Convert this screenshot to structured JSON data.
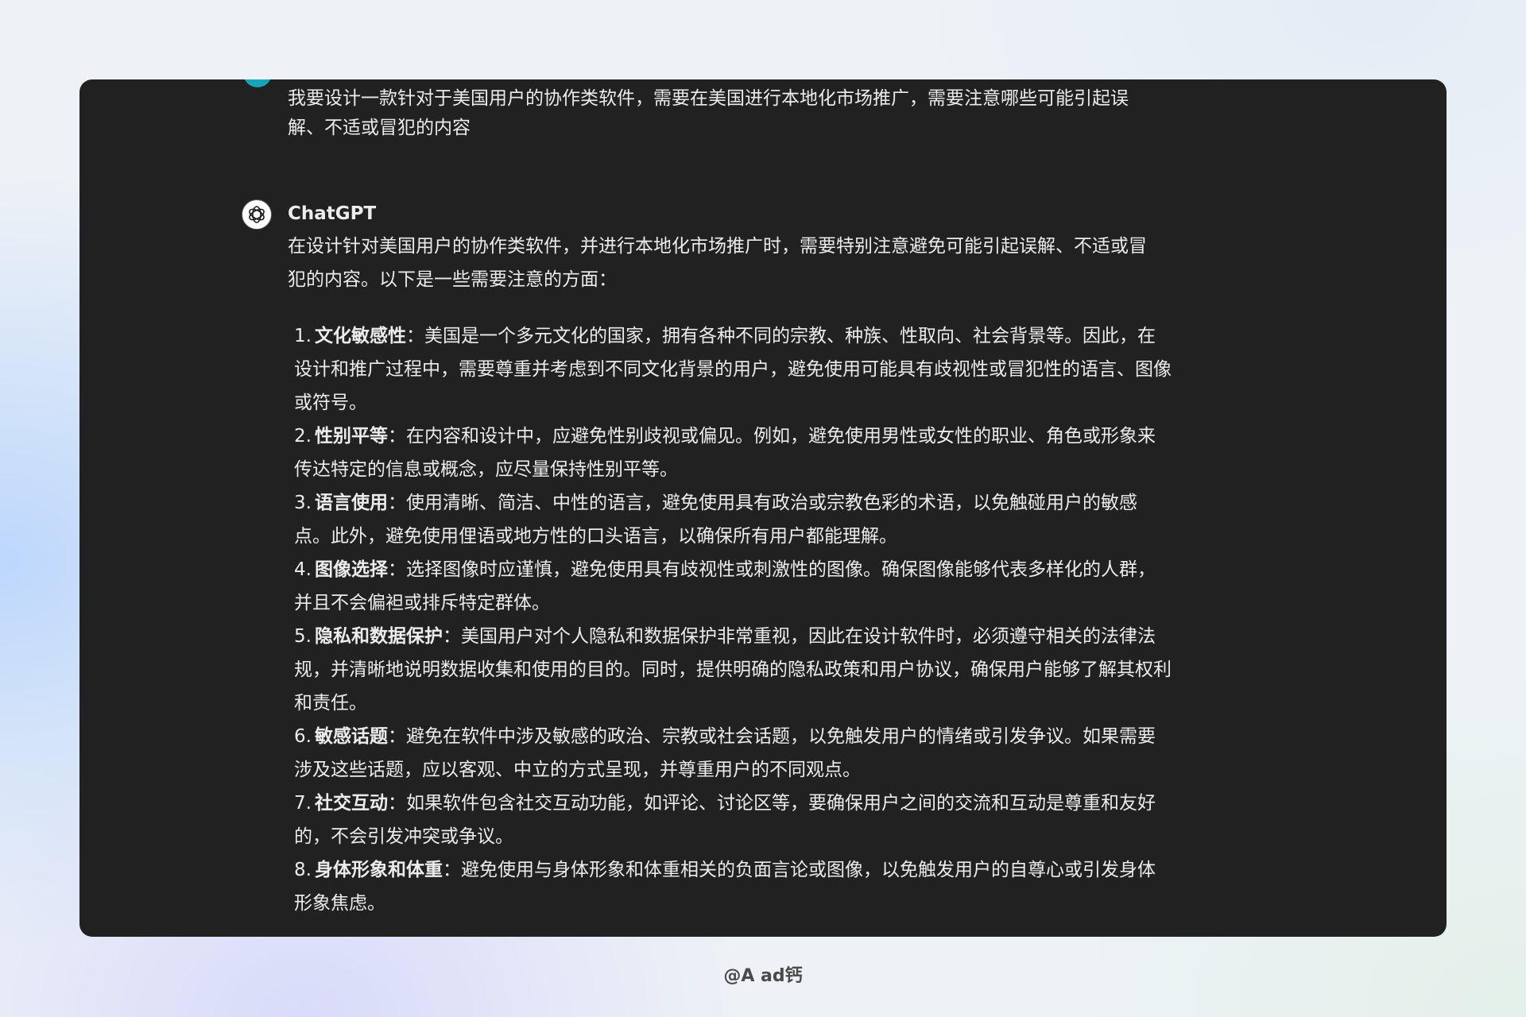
{
  "conversation": {
    "user_message": "我要设计一款针对于美国用户的协作类软件，需要在美国进行本地化市场推广，需要注意哪些可能引起误解、不适或冒犯的内容",
    "assistant": {
      "name": "ChatGPT",
      "intro": "在设计针对美国用户的协作类软件，并进行本地化市场推广时，需要特别注意避免可能引起误解、不适或冒犯的内容。以下是一些需要注意的方面：",
      "points": [
        {
          "number": "1.",
          "title": "文化敏感性",
          "text": "：美国是一个多元文化的国家，拥有各种不同的宗教、种族、性取向、社会背景等。因此，在设计和推广过程中，需要尊重并考虑到不同文化背景的用户，避免使用可能具有歧视性或冒犯性的语言、图像或符号。"
        },
        {
          "number": "2.",
          "title": "性别平等",
          "text": "：在内容和设计中，应避免性别歧视或偏见。例如，避免使用男性或女性的职业、角色或形象来传达特定的信息或概念，应尽量保持性别平等。"
        },
        {
          "number": "3.",
          "title": "语言使用",
          "text": "：使用清晰、简洁、中性的语言，避免使用具有政治或宗教色彩的术语，以免触碰用户的敏感点。此外，避免使用俚语或地方性的口头语言，以确保所有用户都能理解。"
        },
        {
          "number": "4.",
          "title": "图像选择",
          "text": "：选择图像时应谨慎，避免使用具有歧视性或刺激性的图像。确保图像能够代表多样化的人群，并且不会偏袒或排斥特定群体。"
        },
        {
          "number": "5.",
          "title": "隐私和数据保护",
          "text": "：美国用户对个人隐私和数据保护非常重视，因此在设计软件时，必须遵守相关的法律法规，并清晰地说明数据收集和使用的目的。同时，提供明确的隐私政策和用户协议，确保用户能够了解其权利和责任。"
        },
        {
          "number": "6.",
          "title": "敏感话题",
          "text": "：避免在软件中涉及敏感的政治、宗教或社会话题，以免触发用户的情绪或引发争议。如果需要涉及这些话题，应以客观、中立的方式呈现，并尊重用户的不同观点。"
        },
        {
          "number": "7.",
          "title": "社交互动",
          "text": "：如果软件包含社交互动功能，如评论、讨论区等，要确保用户之间的交流和互动是尊重和友好的，不会引发冲突或争议。"
        },
        {
          "number": "8.",
          "title": "身体形象和体重",
          "text": "：避免使用与身体形象和体重相关的负面言论或图像，以免触发用户的自尊心或引发身体形象焦虑。"
        }
      ]
    }
  },
  "watermark": "@A ad钙",
  "icons": {
    "assistant_avatar": "openai-logo-icon",
    "user_avatar": "user-avatar-icon"
  },
  "colors": {
    "card_background": "#212121",
    "text": "#ececec",
    "user_avatar": "#19a3b8",
    "watermark": "#4a4a4a"
  }
}
